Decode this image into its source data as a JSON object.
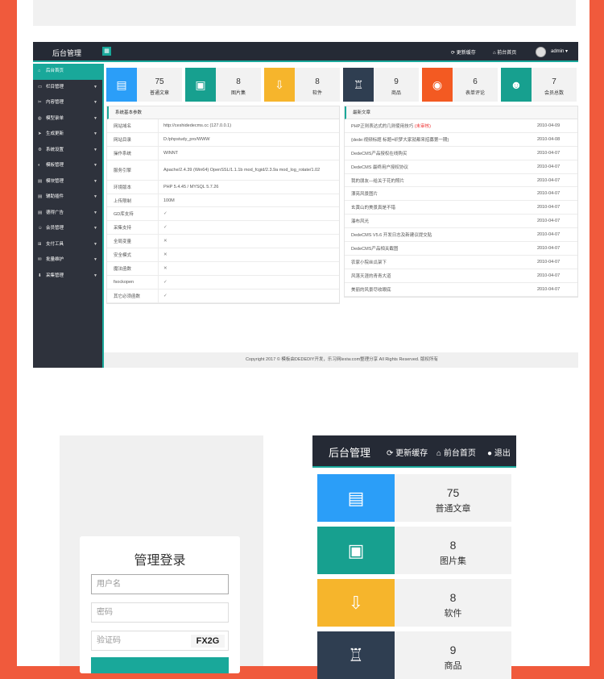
{
  "admin": {
    "header": {
      "title": "后台管理",
      "refresh_cache": "更新缓存",
      "front_home": "前台首页",
      "user": "admin"
    },
    "sidebar": [
      {
        "label": "后台首页",
        "icon": "home-icon",
        "active": true
      },
      {
        "label": "栏目管理",
        "icon": "monitor-icon"
      },
      {
        "label": "内容管理",
        "icon": "tool-icon"
      },
      {
        "label": "模型录单",
        "icon": "globe-icon"
      },
      {
        "label": "生成更新",
        "icon": "send-icon"
      },
      {
        "label": "系统设置",
        "icon": "gear-icon"
      },
      {
        "label": "模板管理",
        "icon": "palette-icon"
      },
      {
        "label": "模块管理",
        "icon": "folder-icon"
      },
      {
        "label": "辅助插件",
        "icon": "folder-icon"
      },
      {
        "label": "德得广告",
        "icon": "folder-icon"
      },
      {
        "label": "会员管理",
        "icon": "user-icon"
      },
      {
        "label": "支付工具",
        "icon": "cart-icon"
      },
      {
        "label": "批量维护",
        "icon": "mail-icon"
      },
      {
        "label": "采集管理",
        "icon": "download-icon"
      }
    ],
    "cards": [
      {
        "num": "75",
        "label": "普通文章",
        "color": "#2b9ef8",
        "icon": "document-icon"
      },
      {
        "num": "8",
        "label": "图片集",
        "color": "#17a08f",
        "icon": "image-icon"
      },
      {
        "num": "8",
        "label": "软件",
        "color": "#f6b52c",
        "icon": "download-box-icon"
      },
      {
        "num": "9",
        "label": "商品",
        "color": "#2f3e51",
        "icon": "tshirt-icon"
      },
      {
        "num": "6",
        "label": "表单评论",
        "color": "#f35a22",
        "icon": "chat-icon"
      },
      {
        "num": "7",
        "label": "会员总数",
        "color": "#17a08f",
        "icon": "users-icon"
      }
    ],
    "sysinfo": {
      "title": "系统基本参数",
      "rows": [
        {
          "k": "网站域名",
          "v": "http://ceshidedecms.cc (127.0.0.1)"
        },
        {
          "k": "网站目录",
          "v": "D:/phpstudy_pro/WWW"
        },
        {
          "k": "操作系统",
          "v": "WINNT"
        },
        {
          "k": "服务引擎",
          "v": "Apache/2.4.39 (Win64) OpenSSL/1.1.1b mod_fcgid/2.3.9a mod_log_rotate/1.02"
        },
        {
          "k": "环境版本",
          "v": "PHP 5.4.45 / MYSQL 5.7.26"
        },
        {
          "k": "上传限制",
          "v": "100M"
        },
        {
          "k": "GD库支持",
          "v": "✓"
        },
        {
          "k": "采集支持",
          "v": "✓"
        },
        {
          "k": "全局变量",
          "v": "✕"
        },
        {
          "k": "安全模式",
          "v": "✕"
        },
        {
          "k": "魔法函数",
          "v": "✕"
        },
        {
          "k": "fsockopen",
          "v": "✓"
        },
        {
          "k": "其它必须函数",
          "v": "✓"
        }
      ]
    },
    "articles": {
      "title": "最新文章",
      "rows": [
        {
          "t": "PHP正则表达式的几则使用技巧",
          "tag": "(未审核)",
          "d": "2010-04-09"
        },
        {
          "t": "{dede:视频标题 标题=织梦大家就都来招募第一期}",
          "tag": "",
          "d": "2010-04-08"
        },
        {
          "t": "DedeCMS产品授权在线购买",
          "tag": "",
          "d": "2010-04-07"
        },
        {
          "t": "DedeCMS 最终用户授权协议",
          "tag": "",
          "d": "2010-04-07"
        },
        {
          "t": "我的朋友—给关于花的照片",
          "tag": "",
          "d": "2010-04-07"
        },
        {
          "t": "漂亮风景图片",
          "tag": "",
          "d": "2010-04-07"
        },
        {
          "t": "玄黄山的美景真是不错",
          "tag": "",
          "d": "2010-04-07"
        },
        {
          "t": "瀑布风光",
          "tag": "",
          "d": "2010-04-07"
        },
        {
          "t": "DedeCMS V5.6 开发日志及新建议提交贴",
          "tag": "",
          "d": "2010-04-07"
        },
        {
          "t": "DedeCMS产品相关截图",
          "tag": "",
          "d": "2010-04-07"
        },
        {
          "t": "农家小院丝瓜架下",
          "tag": "",
          "d": "2010-04-07"
        },
        {
          "t": "风落天涯的青青大道",
          "tag": "",
          "d": "2010-04-07"
        },
        {
          "t": "美丽的风景尽收眼底",
          "tag": "",
          "d": "2010-04-07"
        }
      ]
    },
    "footer": "Copyright 2017 © 模板由DEDEDIY开发，乐习网lexiw.com整理分享 All Rights Reserved. 版权所有"
  },
  "login": {
    "title": "管理登录",
    "username_placeholder": "用户名",
    "password_placeholder": "密码",
    "captcha_placeholder": "验证码",
    "captcha_text": "FX2G"
  },
  "zoom": {
    "title": "后台管理",
    "refresh_cache": "更新缓存",
    "front_home": "前台首页",
    "logout": "退出"
  }
}
